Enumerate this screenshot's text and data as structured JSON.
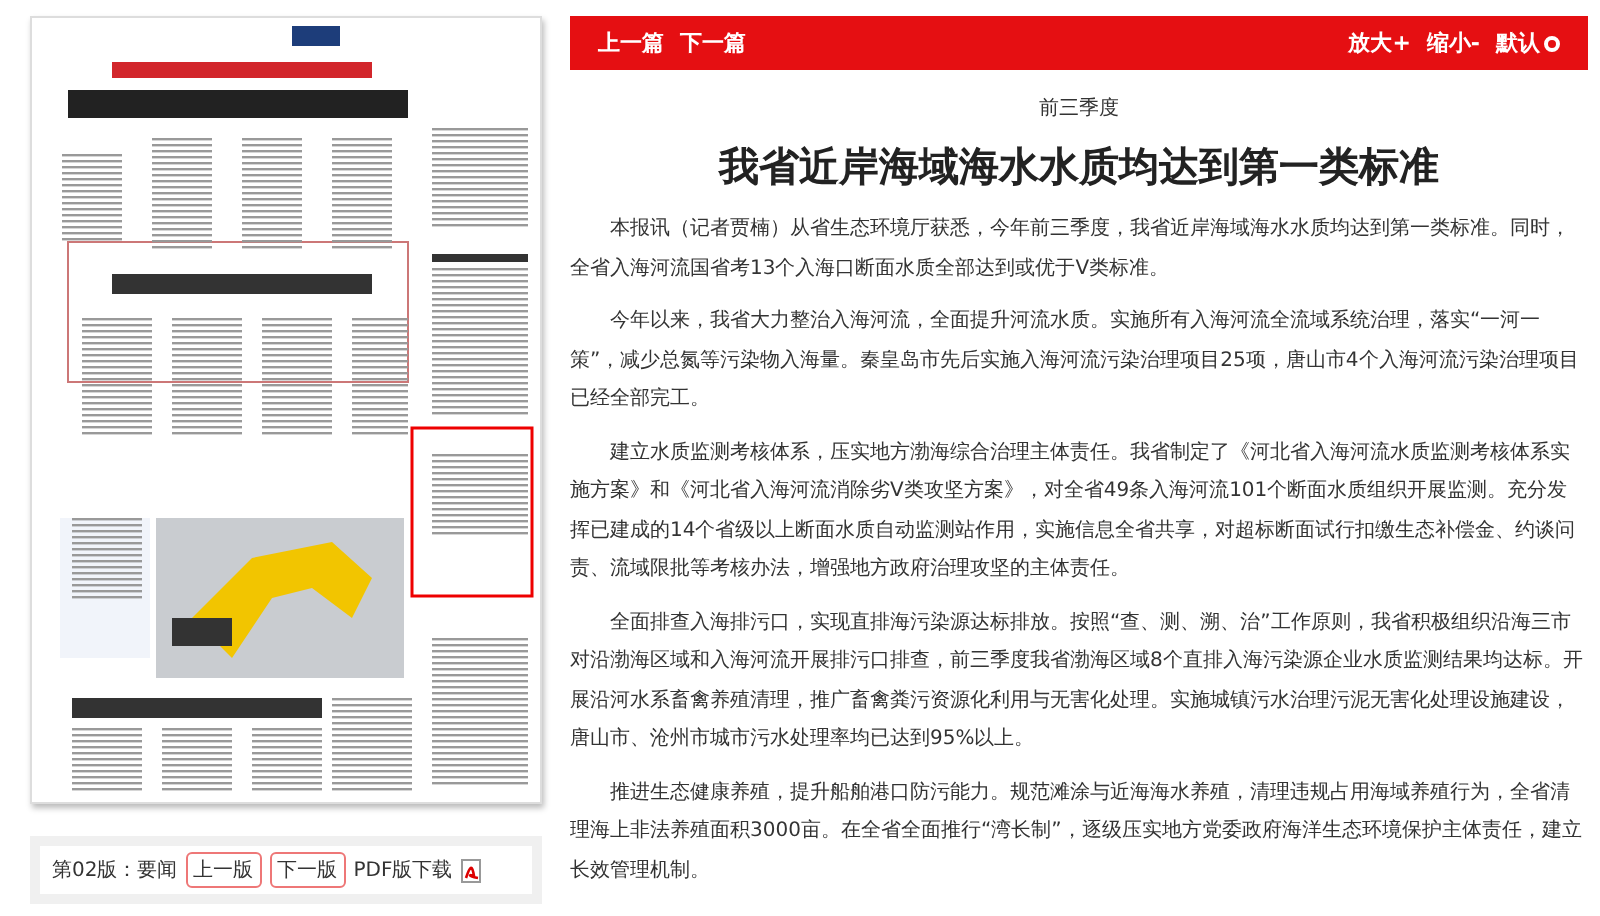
{
  "toolbar": {
    "prev": "上一篇",
    "next": "下一篇",
    "zoom_in": "放大+",
    "zoom_out": "缩小-",
    "reset": "默认"
  },
  "article": {
    "kicker": "前三季度",
    "title": "我省近岸海域海水水质均达到第一类标准",
    "paragraphs": [
      "本报讯（记者贾楠）从省生态环境厅获悉，今年前三季度，我省近岸海域海水水质均达到第一类标准。同时，全省入海河流国省考13个入海口断面水质全部达到或优于Ⅴ类标准。",
      "今年以来，我省大力整治入海河流，全面提升河流水质。实施所有入海河流全流域系统治理，落实“一河一策”，减少总氮等污染物入海量。秦皇岛市先后实施入海河流污染治理项目25项，唐山市4个入海河流污染治理项目已经全部完工。",
      "建立水质监测考核体系，压实地方渤海综合治理主体责任。我省制定了《河北省入海河流水质监测考核体系实施方案》和《河北省入海河流消除劣Ⅴ类攻坚方案》，对全省49条入海河流101个断面水质组织开展监测。充分发挥已建成的14个省级以上断面水质自动监测站作用，实施信息全省共享，对超标断面试行扣缴生态补偿金、约谈问责、流域限批等考核办法，增强地方政府治理攻坚的主体责任。",
      "全面排查入海排污口，实现直排海污染源达标排放。按照“查、测、溯、治”工作原则，我省积极组织沿海三市对沿渤海区域和入海河流开展排污口排查，前三季度我省渤海区域8个直排入海污染源企业水质监测结果均达标。开展沿河水系畜禽养殖清理，推广畜禽粪污资源化利用与无害化处理。实施城镇污水治理污泥无害化处理设施建设，唐山市、沧州市城市污水处理率均已达到95%以上。",
      "推进生态健康养殖，提升船舶港口防污能力。规范滩涂与近海海水养殖，清理违规占用海域养殖行为，全省清理海上非法养殖面积3000亩。在全省全面推行“湾长制”，逐级压实地方党委政府海洋生态环境保护主体责任，建立长效管理机制。"
    ]
  },
  "page_nav": {
    "edition": "第02版：要闻",
    "prev": "上一版",
    "next": "下一版",
    "pdf": "PDF版下载"
  }
}
